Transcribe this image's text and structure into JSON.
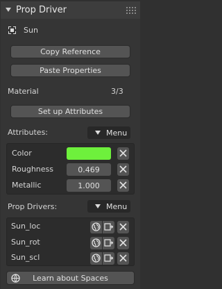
{
  "panel": {
    "title": "Prop Driver"
  },
  "object": {
    "name": "Sun",
    "icon": "object-icon"
  },
  "buttons": {
    "copy_reference": "Copy Reference",
    "paste_properties": "Paste Properties",
    "setup_attributes": "Set up Attributes",
    "learn_spaces": "Learn about Spaces"
  },
  "material": {
    "label": "Material",
    "count": "3/3"
  },
  "attributes": {
    "header": "Attributes:",
    "menu_label": "Menu",
    "items": [
      {
        "name": "Color",
        "value": "",
        "swatch": "#6ef03c"
      },
      {
        "name": "Roughness",
        "value": "0.469"
      },
      {
        "name": "Metallic",
        "value": "1.000"
      }
    ]
  },
  "prop_drivers": {
    "header": "Prop Drivers:",
    "menu_label": "Menu",
    "items": [
      {
        "name": "Sun_loc"
      },
      {
        "name": "Sun_rot"
      },
      {
        "name": "Sun_scl"
      }
    ]
  },
  "colors": {
    "accent_green": "#6ef03c",
    "background": "#303030",
    "button": "#545454"
  }
}
